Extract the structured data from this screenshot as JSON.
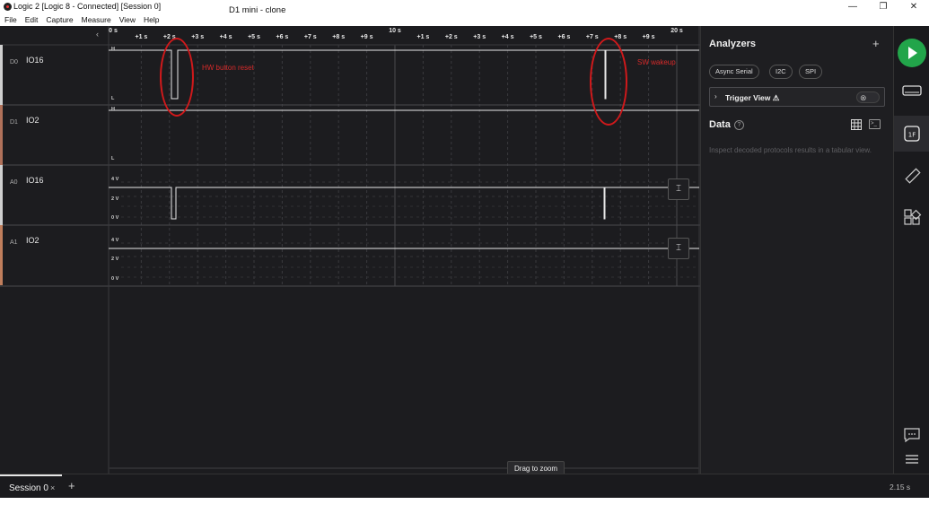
{
  "window": {
    "title": "Logic 2 [Logic 8 - Connected] [Session 0]",
    "document_title": "D1 mini - clone",
    "controls": [
      "—",
      "❐",
      "✕"
    ]
  },
  "menu": [
    "File",
    "Edit",
    "Capture",
    "Measure",
    "View",
    "Help"
  ],
  "timeline": {
    "ticks": [
      "0 s",
      "+1 s",
      "+2 s",
      "+3 s",
      "+4 s",
      "+5 s",
      "+6 s",
      "+7 s",
      "+8 s",
      "+9 s",
      "10 s",
      "+1 s",
      "+2 s",
      "+3 s",
      "+4 s",
      "+5 s",
      "+6 s",
      "+7 s",
      "+8 s",
      "+9 s",
      "20 s"
    ]
  },
  "channels": [
    {
      "id": "D0",
      "name": "IO16",
      "type": "digital",
      "high_label": "H",
      "low_label": "L"
    },
    {
      "id": "D1",
      "name": "IO2",
      "type": "digital",
      "high_label": "H",
      "low_label": "L"
    },
    {
      "id": "A0",
      "name": "IO16",
      "type": "analog",
      "levels": [
        "4 V",
        "2 V",
        "0 V"
      ]
    },
    {
      "id": "A1",
      "name": "IO2",
      "type": "analog",
      "levels": [
        "4 V",
        "2 V",
        "0 V"
      ]
    }
  ],
  "annotations": {
    "hw_reset": "HW button reset",
    "sw_wakeup": "SW wakeup"
  },
  "scale_button_icon": "vertical-scale-icon",
  "drag_hint": "Drag to zoom",
  "analyzers": {
    "title": "Analyzers",
    "add_icon": "plus-icon",
    "chips": [
      "Async Serial",
      "I2C",
      "SPI"
    ],
    "trigger_view": "Trigger View ⚠"
  },
  "data": {
    "title": "Data",
    "empty_text": "Inspect decoded protocols results in a tabular view."
  },
  "toolbar": {
    "icons": [
      "play-icon",
      "device-icon",
      "analyzer-icon",
      "measure-icon",
      "extensions-icon",
      "feedback-icon",
      "menu-icon"
    ]
  },
  "session": {
    "tab_label": "Session 0",
    "close": "×",
    "add": "+",
    "zoom_level": "2.15 s"
  }
}
